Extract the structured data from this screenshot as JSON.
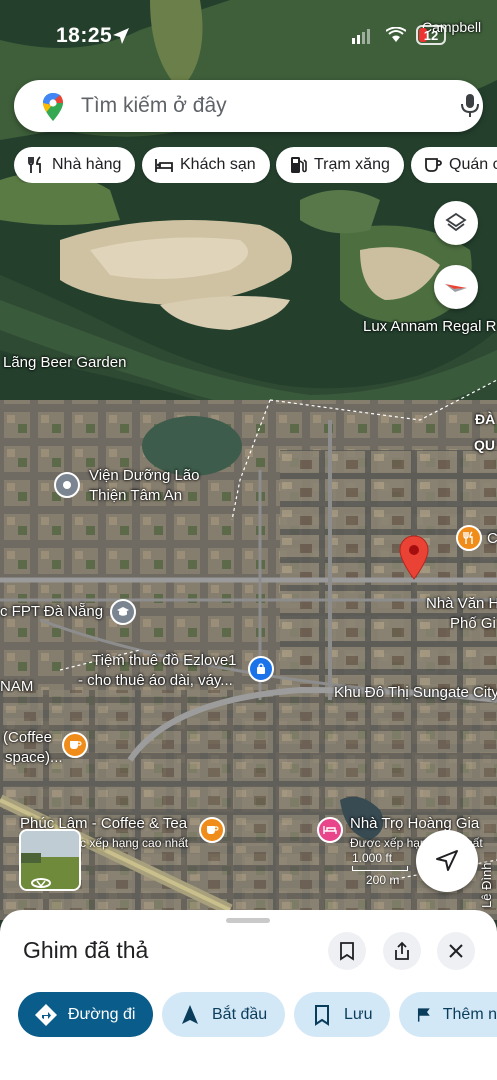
{
  "status_bar": {
    "time": "18:25",
    "battery": "12"
  },
  "search": {
    "placeholder": "Tìm kiếm ở đây"
  },
  "chips": [
    {
      "label": "Nhà hàng",
      "icon": "fork-knife-icon"
    },
    {
      "label": "Khách sạn",
      "icon": "bed-icon"
    },
    {
      "label": "Trạm xăng",
      "icon": "gas-pump-icon"
    },
    {
      "label": "Quán c",
      "icon": "coffee-cup-icon"
    }
  ],
  "map_labels": {
    "campbell": "Campbell",
    "lux_annam": "Lux Annam Regal R",
    "lang_beer": "Lãng Beer Garden",
    "vien_duong_lao_1": "Viện Dưỡng Lão",
    "vien_duong_lao_2": "Thiện Tâm An",
    "fpt": "c FPT Đà Nẵng",
    "tiem_thue_1": "Tiệm thuê đồ Ezlove1",
    "tiem_thue_2": "- cho thuê áo dài, váy...",
    "nam": "NAM",
    "khu_do_thi": "Khu Đô Thị Sungate City",
    "nha_van_hoa_1": "Nhà Văn H",
    "nha_van_hoa_2": "Phố Gi",
    "coffee_1": "(Coffee",
    "coffee_2": "space)...",
    "phuc_lam": "Phúc Lâm - Coffee & Tea",
    "phuc_lam_sub": "c xếp hạng cao nhất",
    "nha_tro": "Nhà Trọ Hoàng Gia",
    "nha_tro_sub": "Được xếp hạng cao nhất",
    "da": "ĐÀ",
    "qu": "QU",
    "le_dinh": "Lê Đình",
    "c_right": "C"
  },
  "scale": {
    "ft": "1.000 ft",
    "m": "200 m"
  },
  "colors": {
    "accent": "#0b57d0",
    "pin": "#ea4335",
    "action_primary": "#0a5c8a",
    "action_bg": "#d3e8f7"
  },
  "sheet": {
    "title": "Ghim đã thả",
    "actions": [
      {
        "label": "Đường đi",
        "icon": "directions-icon"
      },
      {
        "label": "Bắt đầu",
        "icon": "navigation-arrow-icon"
      },
      {
        "label": "Lưu",
        "icon": "bookmark-icon"
      },
      {
        "label": "Thêm n",
        "icon": "flag-icon"
      }
    ]
  }
}
